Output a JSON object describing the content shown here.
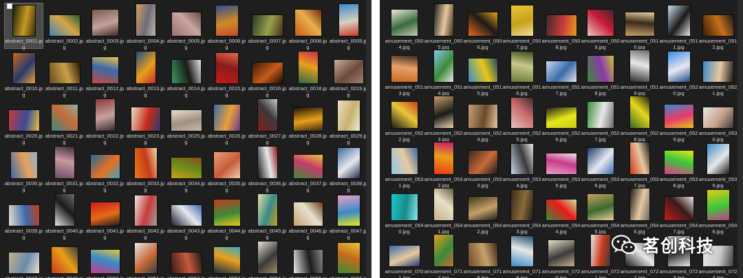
{
  "left_panel": {
    "files": [
      {
        "name": "abstract_0001.jpg",
        "colors": [
          "#1b1a0e",
          "#c39b22",
          "#3a2a10"
        ],
        "selected": true
      },
      {
        "name": "abstract_0002.jpg",
        "colors": [
          "#3d86b8",
          "#d7a546",
          "#2b5a36"
        ]
      },
      {
        "name": "abstract_0003.jpg",
        "colors": [
          "#7a5b4a",
          "#c2a29a",
          "#3e2a25"
        ]
      },
      {
        "name": "abstract_0004.jpg",
        "colors": [
          "#d3a05a",
          "#6e6a7a",
          "#c7b8a8"
        ]
      },
      {
        "name": "abstract_0005.jpg",
        "colors": [
          "#9a7068",
          "#c9a6a0",
          "#6a4a44"
        ]
      },
      {
        "name": "abstract_0006.jpg",
        "colors": [
          "#2d4f8f",
          "#d08a2a",
          "#c84a2a"
        ]
      },
      {
        "name": "abstract_0007.jpg",
        "colors": [
          "#2a3a2a",
          "#9aa04a",
          "#4a2a1a"
        ]
      },
      {
        "name": "abstract_0008.jpg",
        "colors": [
          "#c85a1a",
          "#e8b04a",
          "#6a2a10"
        ]
      },
      {
        "name": "abstract_0009.jpg",
        "colors": [
          "#3a8acb",
          "#d8d0c0",
          "#c83a2a"
        ]
      },
      {
        "name": "abstract_0010.jpg",
        "colors": [
          "#c86a1a",
          "#2a3a6a",
          "#e8a03a"
        ]
      },
      {
        "name": "abstract_0011.jpg",
        "colors": [
          "#6a4a1a",
          "#c8a04a",
          "#2a1a0a"
        ]
      },
      {
        "name": "abstract_0012.jpg",
        "colors": [
          "#c84a3a",
          "#3a6aaa",
          "#e8c84a"
        ]
      },
      {
        "name": "abstract_0013.jpg",
        "colors": [
          "#1a4a8a",
          "#e8a01a",
          "#c82a2a"
        ]
      },
      {
        "name": "abstract_0014.jpg",
        "colors": [
          "#3a9a5a",
          "#1a1a1a",
          "#e8e8e8"
        ]
      },
      {
        "name": "abstract_0015.jpg",
        "colors": [
          "#c81a1a",
          "#8a1a1a",
          "#e86a4a"
        ]
      },
      {
        "name": "abstract_0016.jpg",
        "colors": [
          "#3a1a0a",
          "#c85a1a",
          "#1a0a05"
        ]
      },
      {
        "name": "abstract_0018.jpg",
        "colors": [
          "#2a6a4a",
          "#e8a01a",
          "#c82a4a"
        ]
      },
      {
        "name": "abstract_0019.jpg",
        "colors": [
          "#c8b0a0",
          "#6a4a3a",
          "#a08070"
        ]
      },
      {
        "name": "abstract_0020.jpg",
        "colors": [
          "#c83a3a",
          "#3a4a9a",
          "#e8c03a"
        ]
      },
      {
        "name": "abstract_0021.jpg",
        "colors": [
          "#3a8a7a",
          "#c86a3a",
          "#8ab0a0"
        ]
      },
      {
        "name": "abstract_0022.jpg",
        "colors": [
          "#8a3a3a",
          "#c8a0a0",
          "#3a2a2a"
        ]
      },
      {
        "name": "abstract_0023.jpg",
        "colors": [
          "#e8e0c8",
          "#c82a1a",
          "#2a3a6a"
        ]
      },
      {
        "name": "abstract_0025.jpg",
        "colors": [
          "#e8e0d0",
          "#a09080",
          "#c8b8a8"
        ]
      },
      {
        "name": "abstract_0026.jpg",
        "colors": [
          "#3a6aaa",
          "#e8a03a",
          "#6a3a8a"
        ]
      },
      {
        "name": "abstract_0027.jpg",
        "colors": [
          "#8a1a1a",
          "#3a3a3a",
          "#c8c8c8"
        ]
      },
      {
        "name": "abstract_0028.jpg",
        "colors": [
          "#1a1208",
          "#e8a01a",
          "#3a2a10"
        ]
      },
      {
        "name": "abstract_0029.jpg",
        "colors": [
          "#e8e0c8",
          "#c8b070",
          "#f0ecd8"
        ]
      },
      {
        "name": "abstract_0030.jpg",
        "colors": [
          "#3a6aaa",
          "#e8a05a",
          "#8ab0d0"
        ]
      },
      {
        "name": "abstract_0031.jpg",
        "colors": [
          "#6a4a6a",
          "#c89aa0",
          "#3a2a3a"
        ]
      },
      {
        "name": "abstract_0032.jpg",
        "colors": [
          "#1a6aaa",
          "#e8701a",
          "#3aa0c8"
        ]
      },
      {
        "name": "abstract_0033.jpg",
        "colors": [
          "#e87a1a",
          "#c83a1a",
          "#f0d8a0"
        ]
      },
      {
        "name": "abstract_0034.jpg",
        "colors": [
          "#c8a01a",
          "#6a8a1a",
          "#8a4a1a"
        ]
      },
      {
        "name": "abstract_0035.jpg",
        "colors": [
          "#e8a07a",
          "#c85a3a",
          "#f0d0b0"
        ]
      },
      {
        "name": "abstract_0036.jpg",
        "colors": [
          "#1a1a1a",
          "#e8e8e8",
          "#8a1a1a"
        ]
      },
      {
        "name": "abstract_0037.jpg",
        "colors": [
          "#3a8a3a",
          "#c83a6a",
          "#e8c83a"
        ]
      },
      {
        "name": "abstract_0038.jpg",
        "colors": [
          "#3a6a9a",
          "#e8e8f0",
          "#1a2a4a"
        ]
      },
      {
        "name": "abstract_0039.jpg",
        "colors": [
          "#e8e0d0",
          "#3a6aaa",
          "#c83a1a"
        ]
      },
      {
        "name": "abstract_0040.jpg",
        "colors": [
          "#e8e8e8",
          "#1a1a1a",
          "#6a6a6a"
        ]
      },
      {
        "name": "abstract_0041.jpg",
        "colors": [
          "#c81a1a",
          "#e86a1a",
          "#1a1a1a"
        ]
      },
      {
        "name": "abstract_0042.jpg",
        "colors": [
          "#e8e8e8",
          "#c83a3a",
          "#a0a0a0"
        ]
      },
      {
        "name": "abstract_0043.jpg",
        "colors": [
          "#1a1a2a",
          "#e8e8f0",
          "#3a6aaa"
        ]
      },
      {
        "name": "abstract_0044.jpg",
        "colors": [
          "#c83a1a",
          "#3a8a3a",
          "#e8c81a"
        ]
      },
      {
        "name": "abstract_0045.jpg",
        "colors": [
          "#e8e0a0",
          "#3a8a8a",
          "#c8a01a"
        ]
      },
      {
        "name": "abstract_0046.jpg",
        "colors": [
          "#c8a070",
          "#e8e0d0",
          "#6a3a1a"
        ]
      },
      {
        "name": "abstract_0047.jpg",
        "colors": [
          "#e8a0c8",
          "#3a8ac8",
          "#e8e81a"
        ]
      },
      {
        "name": "abstract_0048.jpg",
        "colors": [
          "#c8b090",
          "#6a8aaa",
          "#e8e0d0"
        ]
      },
      {
        "name": "abstract_0049.jpg",
        "colors": [
          "#c83a1a",
          "#e8a01a",
          "#3a3a3a"
        ]
      },
      {
        "name": "abstract_0050.jpg",
        "colors": [
          "#c83a8a",
          "#3a8ac8",
          "#e8c83a"
        ]
      },
      {
        "name": "abstract_0051.jpg",
        "colors": [
          "#e8e8e8",
          "#c86a3a",
          "#3a3a3a"
        ]
      },
      {
        "name": "abstract_0052.jpg",
        "colors": [
          "#3a1a1a",
          "#c85a3a",
          "#1a1a1a"
        ]
      },
      {
        "name": "abstract_0053.jpg",
        "colors": [
          "#1a2a4a",
          "#e8a01a",
          "#3aaac8"
        ]
      },
      {
        "name": "abstract_0054.jpg",
        "colors": [
          "#e8e0c8",
          "#3a3a3a",
          "#a08a6a"
        ]
      },
      {
        "name": "abstract_0055.jpg",
        "colors": [
          "#e8e8e8",
          "#1a1a1a",
          "#8a8a8a"
        ]
      },
      {
        "name": "abstract_0056.jpg",
        "colors": [
          "#3a8a3a",
          "#c86a1a",
          "#e8c83a"
        ]
      }
    ]
  },
  "right_panel": {
    "files": [
      {
        "name": "amusement_0504.jpg",
        "colors": [
          "#e8e8e0",
          "#3a6a3a",
          "#c8c8c0"
        ]
      },
      {
        "name": "amusement_0505.jpg",
        "colors": [
          "#1a1a1a",
          "#e8c8a0",
          "#3a2a1a"
        ]
      },
      {
        "name": "amusement_0506.jpg",
        "colors": [
          "#e86a1a",
          "#1a1a1a",
          "#e8a01a"
        ]
      },
      {
        "name": "amusement_0507.jpg",
        "colors": [
          "#e8c83a",
          "#c8a01a",
          "#f0e0a0"
        ]
      },
      {
        "name": "amusement_0508.jpg",
        "colors": [
          "#3a2a2a",
          "#c83a3a",
          "#e8a01a"
        ]
      },
      {
        "name": "amusement_0509.jpg",
        "colors": [
          "#e8c8c0",
          "#c81a3a",
          "#3a2a2a"
        ]
      },
      {
        "name": "amusement_0510.jpg",
        "colors": [
          "#c8a06a",
          "#3a2a1a",
          "#e8d0a0"
        ]
      },
      {
        "name": "amusement_0511.jpg",
        "colors": [
          "#c8e0f0",
          "#1a1a1a",
          "#e8e8e8"
        ]
      },
      {
        "name": "amusement_0512.jpg",
        "colors": [
          "#3a1a0a",
          "#c8701a",
          "#1a1a1a"
        ]
      },
      {
        "name": "amusement_0513.jpg",
        "colors": [
          "#c86a1a",
          "#e8a06a",
          "#3a2a1a"
        ]
      },
      {
        "name": "amusement_0514.jpg",
        "colors": [
          "#8ac8e8",
          "#3a8a3a",
          "#e8e8e8"
        ]
      },
      {
        "name": "amusement_0515.jpg",
        "colors": [
          "#3a8ac8",
          "#e8c81a",
          "#1a4a6a"
        ]
      },
      {
        "name": "amusement_0516.jpg",
        "colors": [
          "#6a7a3a",
          "#c8c88a",
          "#3a4a1a"
        ]
      },
      {
        "name": "amusement_0517.jpg",
        "colors": [
          "#c8d8f0",
          "#3a6aaa",
          "#e8e8f0"
        ]
      },
      {
        "name": "amusement_0518.jpg",
        "colors": [
          "#3a8a3a",
          "#8a3aaa",
          "#c8c83a"
        ]
      },
      {
        "name": "amusement_0519.jpg",
        "colors": [
          "#2a2a2a",
          "#e8e8e8",
          "#6a6a6a"
        ]
      },
      {
        "name": "amusement_0520.jpg",
        "colors": [
          "#3a8ae8",
          "#e8e8f0",
          "#1a4a8a"
        ]
      },
      {
        "name": "amusement_0521.jpg",
        "colors": [
          "#3a8ac8",
          "#e8c8a0",
          "#1a1a1a"
        ]
      },
      {
        "name": "amusement_0522.jpg",
        "colors": [
          "#1a1a1a",
          "#e8c83a",
          "#c83a1a"
        ]
      },
      {
        "name": "amusement_0523.jpg",
        "colors": [
          "#c8a06a",
          "#1a1a1a",
          "#e8d0b0"
        ]
      },
      {
        "name": "amusement_0524.jpg",
        "colors": [
          "#c8a07a",
          "#6a4a2a",
          "#e8c8a0"
        ]
      },
      {
        "name": "amusement_0525.jpg",
        "colors": [
          "#e8c0c0",
          "#c86a6a",
          "#3a2a2a"
        ]
      },
      {
        "name": "amusement_0526.jpg",
        "colors": [
          "#1a1a1a",
          "#e8e81a",
          "#c8c81a"
        ]
      },
      {
        "name": "amusement_0527.jpg",
        "colors": [
          "#3a8a3a",
          "#e8e8e8",
          "#6a6a6a"
        ]
      },
      {
        "name": "amusement_0528.jpg",
        "colors": [
          "#3a6a2a",
          "#e8d81a",
          "#1a1a1a"
        ]
      },
      {
        "name": "amusement_0529.jpg",
        "colors": [
          "#3a8ac8",
          "#e83a6a",
          "#e8c81a"
        ]
      },
      {
        "name": "amusement_0530.jpg",
        "colors": [
          "#e8e8e8",
          "#c8a08a",
          "#3a3a3a"
        ]
      },
      {
        "name": "amusement_0531.jpg",
        "colors": [
          "#8ac8e8",
          "#e8c8a0",
          "#3a6aaa"
        ]
      },
      {
        "name": "amusement_0532.jpg",
        "colors": [
          "#e83a1a",
          "#e8a01a",
          "#c81a6a"
        ]
      },
      {
        "name": "amusement_0533.jpg",
        "colors": [
          "#3a2a1a",
          "#c86a3a",
          "#1a1a1a"
        ]
      },
      {
        "name": "amusement_0534.jpg",
        "colors": [
          "#c8d8e8",
          "#3a3a3a",
          "#e8e8f0"
        ]
      },
      {
        "name": "amusement_0535.jpg",
        "colors": [
          "#e8a0c8",
          "#c83a8a",
          "#f0e0e8"
        ]
      },
      {
        "name": "amusement_0536.jpg",
        "colors": [
          "#1a3a6a",
          "#e8e8f0",
          "#3a6aaa"
        ]
      },
      {
        "name": "amusement_0537.jpg",
        "colors": [
          "#c83a1a",
          "#e8c8a0",
          "#1a1a1a"
        ]
      },
      {
        "name": "amusement_0538.jpg",
        "colors": [
          "#e83a8a",
          "#3ac83a",
          "#e8e81a"
        ]
      },
      {
        "name": "amusement_0539.jpg",
        "colors": [
          "#3a8ac8",
          "#e8e8e8",
          "#1a1a1a"
        ]
      },
      {
        "name": "amusement_0540.jpg",
        "colors": [
          "#1ac8c8",
          "#1a8a8a",
          "#8ae8e8"
        ]
      },
      {
        "name": "amusement_0541.jpg",
        "colors": [
          "#c8b08a",
          "#e8e0c8",
          "#6a5a3a"
        ]
      },
      {
        "name": "amusement_0542.jpg",
        "colors": [
          "#3a3a1a",
          "#c8a06a",
          "#1a1a1a"
        ]
      },
      {
        "name": "amusement_0543.jpg",
        "colors": [
          "#3a2a1a",
          "#8a6a3a",
          "#1a1a1a"
        ]
      },
      {
        "name": "amusement_0544.jpg",
        "colors": [
          "#3a8a3a",
          "#e81a1a",
          "#c8e8a0"
        ]
      },
      {
        "name": "amusement_0545.jpg",
        "colors": [
          "#c8a06a",
          "#3a6a2a",
          "#e8d0a0"
        ]
      },
      {
        "name": "amusement_0546.jpg",
        "colors": [
          "#1a1a1a",
          "#e8c8a0",
          "#6a6a6a"
        ]
      },
      {
        "name": "amusement_0547.jpg",
        "colors": [
          "#c81a1a",
          "#3a1a1a",
          "#e8e8e8"
        ]
      },
      {
        "name": "amusement_0548.jpg",
        "colors": [
          "#e8c81a",
          "#3ac83a",
          "#c83a8a"
        ]
      },
      {
        "name": "amusement_0701.jpg",
        "colors": [
          "#3a6aaa",
          "#e8c8a0",
          "#1a3a6a"
        ]
      },
      {
        "name": "amusement_0717.jpg",
        "colors": [
          "#e8a01a",
          "#3a8a3a",
          "#c86a3a"
        ]
      },
      {
        "name": "amusement_0718.jpg",
        "colors": [
          "#6a4a2a",
          "#c8a06a",
          "#3a2a1a"
        ]
      },
      {
        "name": "amusement_0719.jpg",
        "colors": [
          "#3a8ac8",
          "#e8e8e8",
          "#1a4a6a"
        ]
      },
      {
        "name": "amusement_0720.jpg",
        "colors": [
          "#e8e0c8",
          "#3a3a3a",
          "#c8b08a"
        ]
      },
      {
        "name": "amusement_0721.jpg",
        "colors": [
          "#e8e8e8",
          "#c83a1a",
          "#3a3a3a"
        ]
      },
      {
        "name": "amusement_0722.jpg",
        "colors": [
          "#1a1a1a",
          "#e8e8e8",
          "#6a6a6a"
        ]
      },
      {
        "name": "amusement_0723.jpg",
        "colors": [
          "#c8c8c8",
          "#3a3a3a",
          "#e8e8e8"
        ]
      },
      {
        "name": "amusement_0724.jpg",
        "colors": [
          "#e8e8e8",
          "#c8c8c8",
          "#3a3a3a"
        ]
      }
    ]
  },
  "watermark": {
    "text": "茗创科技",
    "icon": "wechat-icon"
  },
  "select_all_checkbox": {
    "checked": false
  },
  "theme": {
    "background": "#1e1e1e",
    "label": "#d2d2d2",
    "selection": "#4a4a4a"
  }
}
